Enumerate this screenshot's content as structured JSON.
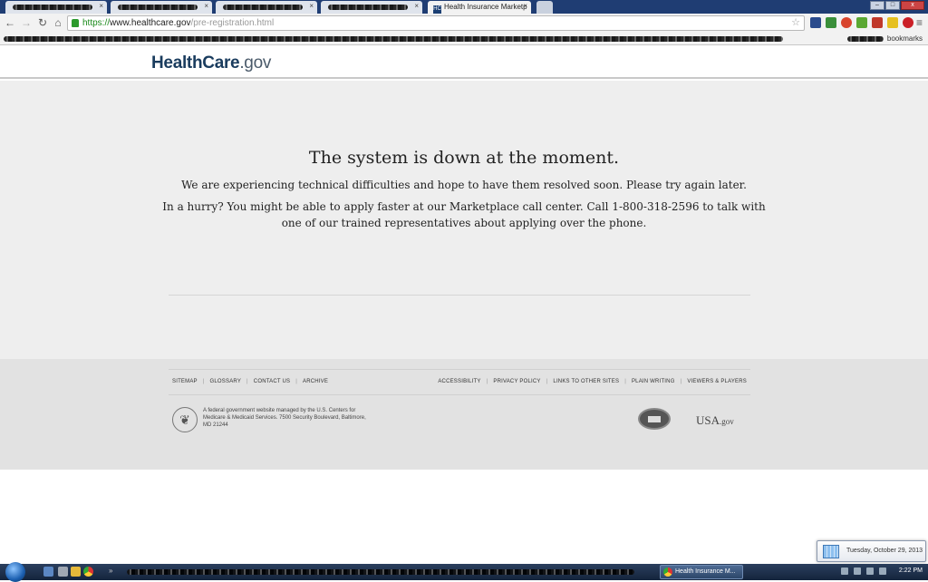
{
  "browser": {
    "tabs": [
      {
        "title": "",
        "active": false
      },
      {
        "title": "",
        "active": false
      },
      {
        "title": "",
        "active": false
      },
      {
        "title": "Health Insurance Marketp",
        "active": true
      }
    ],
    "url": {
      "scheme": "https://",
      "host": "www.healthcare.gov",
      "path": "/pre-registration.html"
    },
    "bookmarks_other": "bookmarks",
    "window_buttons": {
      "minimize": "–",
      "maximize": "□",
      "close": "x"
    }
  },
  "site": {
    "logo": {
      "main": "HealthCare",
      "suffix": ".gov"
    },
    "message": {
      "title": "The system is down at the moment.",
      "line1": "We are experiencing technical difficulties and hope to have them resolved soon. Please try again later.",
      "line2": "In a hurry? You might be able to apply faster at our Marketplace call center. Call 1-800-318-2596 to talk with one of our trained representatives about applying over the phone."
    },
    "footer": {
      "left_links": [
        "SITEMAP",
        "GLOSSARY",
        "CONTACT US",
        "ARCHIVE"
      ],
      "right_links": [
        "ACCESSIBILITY",
        "PRIVACY POLICY",
        "LINKS TO OTHER SITES",
        "PLAIN WRITING",
        "VIEWERS & PLAYERS"
      ],
      "notice": "A federal government website managed by the U.S. Centers for Medicare & Medicaid Services. 7500 Security Boulevard, Baltimore, MD 21244",
      "usagov": {
        "main": "USA",
        "suffix": ".gov"
      }
    }
  },
  "taskbar": {
    "task_label": "Health Insurance M...",
    "time": "2:22 PM",
    "date_popup": "Tuesday, October 29, 2013"
  },
  "colors": {
    "logo_blue": "#1a3c5e",
    "content_bg": "#eeeeee",
    "footer_bg": "#e2e2e2",
    "url_green": "#1a8a1a"
  }
}
